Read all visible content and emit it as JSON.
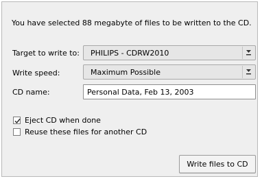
{
  "dialog": {
    "summary": "You have selected 88 megabyte of files to be written to the CD.",
    "target": {
      "label": "Target to write to:",
      "value": "PHILIPS - CDRW2010"
    },
    "speed": {
      "label": "Write speed:",
      "value": "Maximum Possible"
    },
    "cd_name": {
      "label": "CD name:",
      "value": "Personal Data, Feb 13, 2003"
    },
    "options": {
      "eject": {
        "label": "Eject CD when done",
        "checked": true
      },
      "reuse": {
        "label": "Reuse these files for another CD",
        "checked": false
      }
    },
    "write_button": "Write files to CD"
  },
  "icons": {
    "combo_arrow": "chevron-down-icon",
    "check_mark": "checkmark-icon"
  }
}
